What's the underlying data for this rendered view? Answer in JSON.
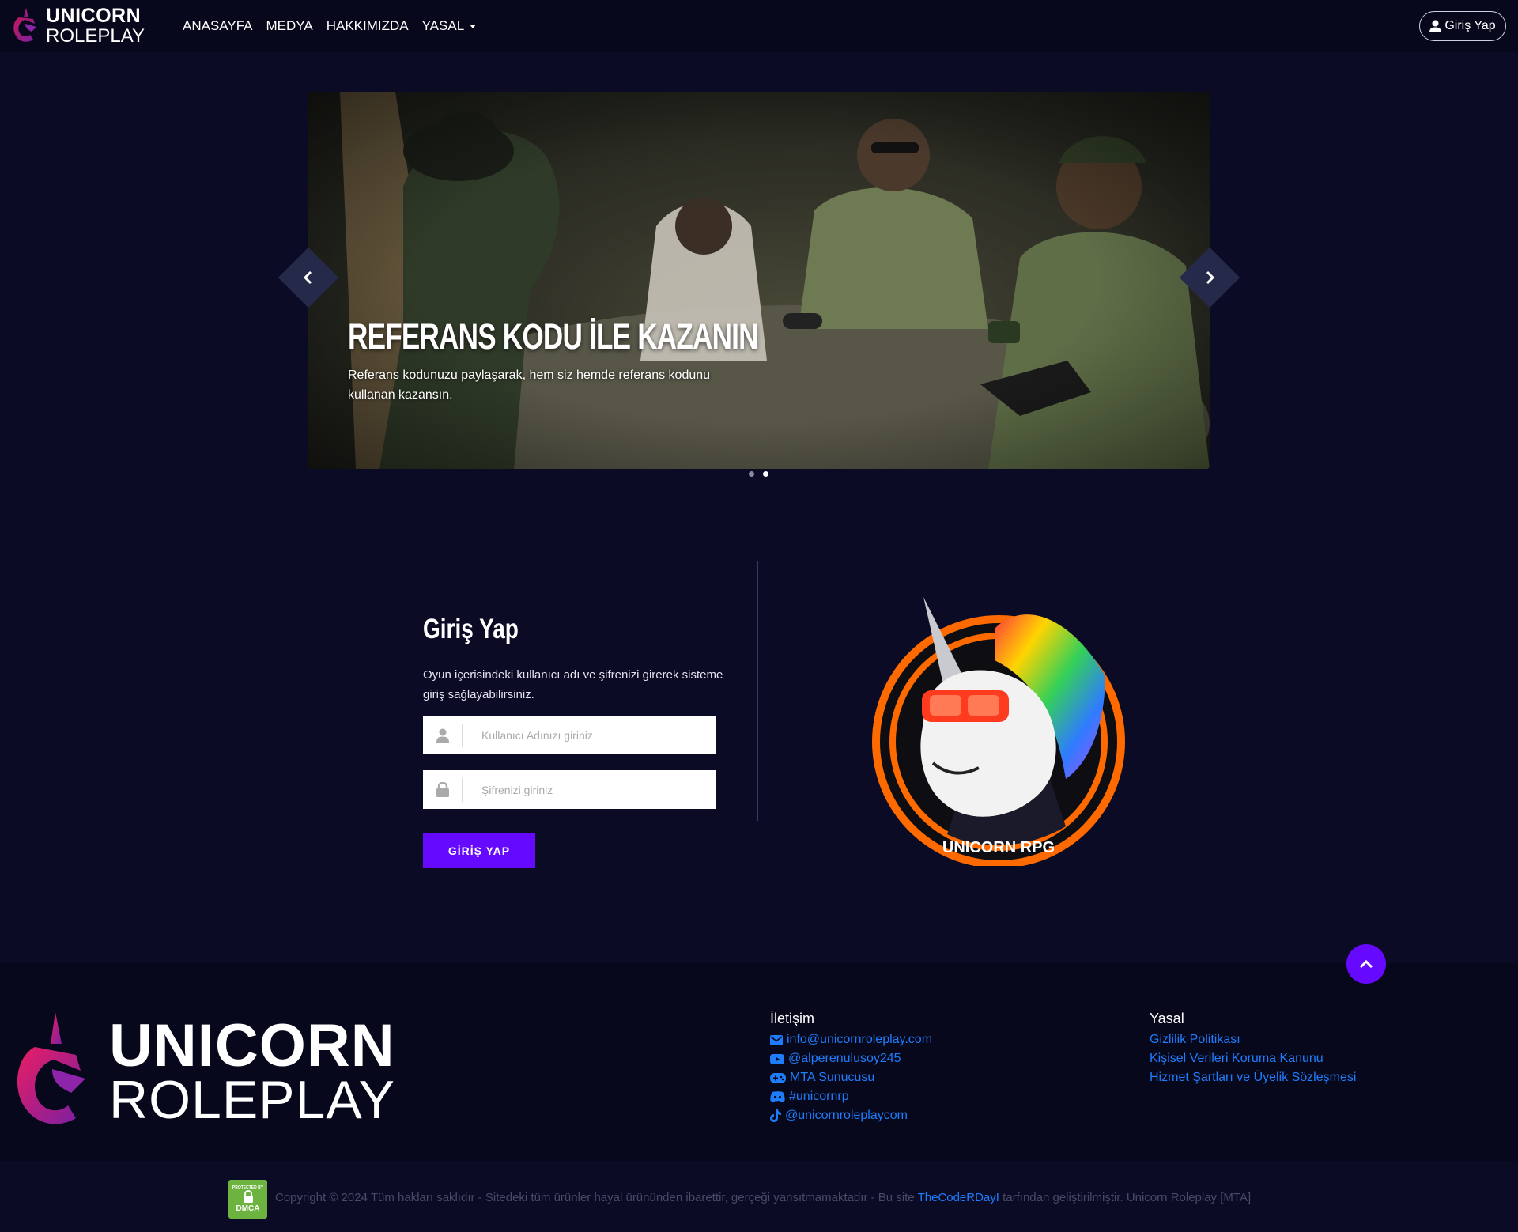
{
  "brand": {
    "line1": "UNICORN",
    "line2": "ROLEPLAY"
  },
  "nav": {
    "items": [
      {
        "label": "ANASAYFA"
      },
      {
        "label": "MEDYA"
      },
      {
        "label": "HAKKIMIZDA"
      },
      {
        "label": "YASAL"
      }
    ],
    "login_label": "Giriş Yap"
  },
  "carousel": {
    "title": "REFERANS KODU İLE KAZANIN",
    "text": "Referans kodunuzu paylaşarak, hem siz hemde referans kodunu kullanan kazansın.",
    "slide_count": 2,
    "active_index": 1
  },
  "login": {
    "title": "Giriş Yap",
    "description": "Oyun içerisindeki kullanıcı adı ve şifrenizi girerek sisteme giriş sağlayabilirsiniz.",
    "username_placeholder": "Kullanıcı Adınızı giriniz",
    "password_placeholder": "Şifrenizi giriniz",
    "submit_label": "GİRİŞ YAP"
  },
  "badge": {
    "text": "UNICORN RPG"
  },
  "footer": {
    "logo_line1": "UNICORN",
    "logo_line2": "ROLEPLAY",
    "contact": {
      "title": "İletişim",
      "items": [
        {
          "icon": "envelope-icon",
          "label": "info@unicornroleplay.com"
        },
        {
          "icon": "youtube-icon",
          "label": "@alperenulusoy245"
        },
        {
          "icon": "gamepad-icon",
          "label": "MTA Sunucusu"
        },
        {
          "icon": "discord-icon",
          "label": "#unicornrp"
        },
        {
          "icon": "tiktok-icon",
          "label": "@unicornroleplaycom"
        }
      ]
    },
    "legal": {
      "title": "Yasal",
      "items": [
        {
          "label": "Gizlilik Politikası"
        },
        {
          "label": "Kişisel Verileri Koruma Kanunu"
        },
        {
          "label": "Hizmet Şartları ve Üyelik Sözleşmesi"
        }
      ]
    },
    "copyright_before": "Copyright © 2024 Tüm hakları saklıdır - Sitedeki tüm ürünler hayal ürününden ibarettir, gerçeği yansıtmamaktadır - Bu site ",
    "copyright_link": "TheCodeRDayI",
    "copyright_after": " tarfından geliştirilmiştir. Unicorn Roleplay [MTA]",
    "dmca_top": "PROTECTED BY",
    "dmca_bottom": "DMCA"
  },
  "colors": {
    "background": "#0b0b25",
    "nav_background": "#08081c",
    "accent": "#6609ff",
    "link": "#1d7dfc"
  }
}
